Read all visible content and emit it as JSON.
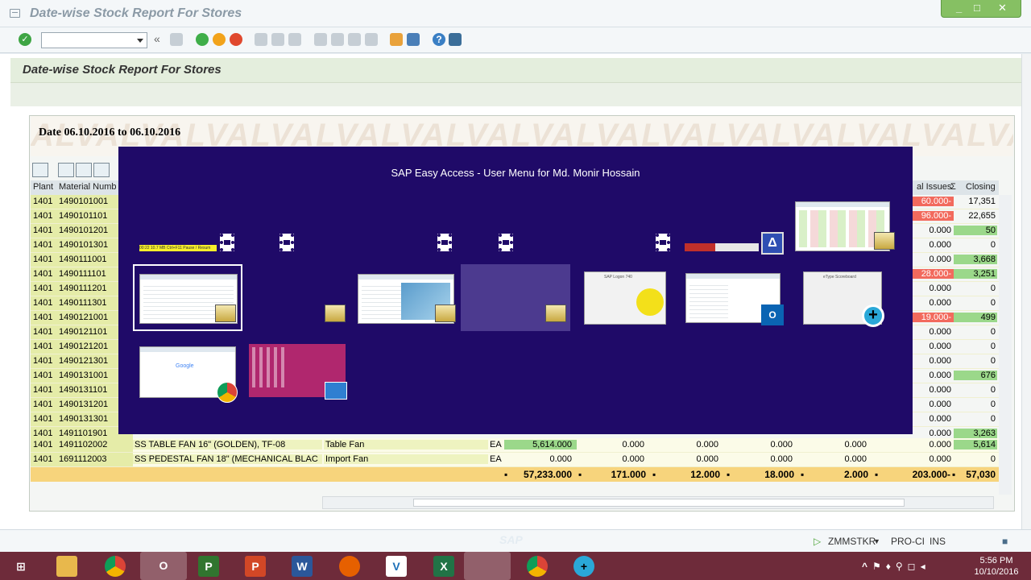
{
  "window": {
    "title": "Date-wise Stock Report For Stores",
    "controls": [
      "_",
      "□",
      "✕"
    ]
  },
  "toolbar": {
    "command_field": "",
    "back_symbol": "«"
  },
  "report": {
    "title": "Date-wise Stock Report For Stores",
    "watermark": "ALVALVALVALVALVALVALVALVALVALVALVALVALVALVALVALV",
    "date_range": "Date 06.10.2016 to 06.10.2016"
  },
  "grid": {
    "headers": {
      "plant": "Plant",
      "material": "Material Numb",
      "issues": "al Issues",
      "sigma": "Σ",
      "closing": "Closing"
    },
    "rows": [
      {
        "plant": "1401",
        "material": "1490101001",
        "issues": "60.000-",
        "issues_state": "neg",
        "closing": "17,351",
        "closing_state": "none"
      },
      {
        "plant": "1401",
        "material": "1490101101",
        "issues": "96.000-",
        "issues_state": "neg",
        "closing": "22,655",
        "closing_state": "none"
      },
      {
        "plant": "1401",
        "material": "1490101201",
        "issues": "0.000",
        "issues_state": "none",
        "closing": "50",
        "closing_state": "pos"
      },
      {
        "plant": "1401",
        "material": "1490101301",
        "issues": "0.000",
        "issues_state": "none",
        "closing": "0",
        "closing_state": "none"
      },
      {
        "plant": "1401",
        "material": "1490111001",
        "issues": "0.000",
        "issues_state": "none",
        "closing": "3,668",
        "closing_state": "pos"
      },
      {
        "plant": "1401",
        "material": "1490111101",
        "issues": "28.000-",
        "issues_state": "neg",
        "closing": "3,251",
        "closing_state": "pos"
      },
      {
        "plant": "1401",
        "material": "1490111201",
        "issues": "0.000",
        "issues_state": "none",
        "closing": "0",
        "closing_state": "none"
      },
      {
        "plant": "1401",
        "material": "1490111301",
        "issues": "0.000",
        "issues_state": "none",
        "closing": "0",
        "closing_state": "none"
      },
      {
        "plant": "1401",
        "material": "1490121001",
        "issues": "19.000-",
        "issues_state": "neg",
        "closing": "499",
        "closing_state": "pos"
      },
      {
        "plant": "1401",
        "material": "1490121101",
        "issues": "0.000",
        "issues_state": "none",
        "closing": "0",
        "closing_state": "none"
      },
      {
        "plant": "1401",
        "material": "1490121201",
        "issues": "0.000",
        "issues_state": "none",
        "closing": "0",
        "closing_state": "none"
      },
      {
        "plant": "1401",
        "material": "1490121301",
        "issues": "0.000",
        "issues_state": "none",
        "closing": "0",
        "closing_state": "none"
      },
      {
        "plant": "1401",
        "material": "1490131001",
        "issues": "0.000",
        "issues_state": "none",
        "closing": "676",
        "closing_state": "pos"
      },
      {
        "plant": "1401",
        "material": "1490131101",
        "issues": "0.000",
        "issues_state": "none",
        "closing": "0",
        "closing_state": "none"
      },
      {
        "plant": "1401",
        "material": "1490131201",
        "issues": "0.000",
        "issues_state": "none",
        "closing": "0",
        "closing_state": "none"
      },
      {
        "plant": "1401",
        "material": "1490131301",
        "issues": "0.000",
        "issues_state": "none",
        "closing": "0",
        "closing_state": "none"
      },
      {
        "plant": "1401",
        "material": "1491101901",
        "issues": "0.000",
        "issues_state": "none",
        "closing": "3,263",
        "closing_state": "pos"
      }
    ],
    "full_rows": [
      {
        "plant": "1401",
        "material": "1491102002",
        "desc": "SS TABLE FAN 16\" (GOLDEN), TF-08",
        "group": "Table Fan",
        "unit": "EA",
        "opening": "5,614.000",
        "c1": "0.000",
        "c2": "0.000",
        "c3": "0.000",
        "c4": "0.000",
        "issues": "0.000",
        "closing": "5,614"
      },
      {
        "plant": "1401",
        "material": "1691112003",
        "desc": "SS PEDESTAL FAN 18\" (MECHANICAL BLAC",
        "group": "Import Fan",
        "unit": "EA",
        "opening": "0.000",
        "c1": "0.000",
        "c2": "0.000",
        "c3": "0.000",
        "c4": "0.000",
        "issues": "0.000",
        "closing": "0"
      }
    ],
    "totals": {
      "opening": "57,233.000",
      "c1": "171.000",
      "c2": "12.000",
      "c3": "18.000",
      "c4": "2.000",
      "issues": "203.000-",
      "closing": "57,030"
    },
    "total_marker": "▪"
  },
  "switcher": {
    "title": "SAP Easy Access  -  User Menu for Md. Monir Hossain",
    "thumb_sap_logon": "SAP Logon 740",
    "thumb_scoreboard": "eType Scoreboard",
    "thumb_google": "Google",
    "thumb_timer": "00:22 10.7 MB Ctrl+F11 Pause / Resum"
  },
  "status": {
    "transaction": "ZMMSTKR",
    "system": "PRO-CI",
    "mode": "INS",
    "sap_logo": "SAP"
  },
  "taskbar": {
    "apps": [
      "explorer",
      "chrome",
      "outlook",
      "project",
      "powerpoint",
      "word",
      "firefox",
      "vnc",
      "excel",
      "sap",
      "chrome",
      "etype"
    ],
    "time": "5:56 PM",
    "date": "10/10/2016"
  }
}
